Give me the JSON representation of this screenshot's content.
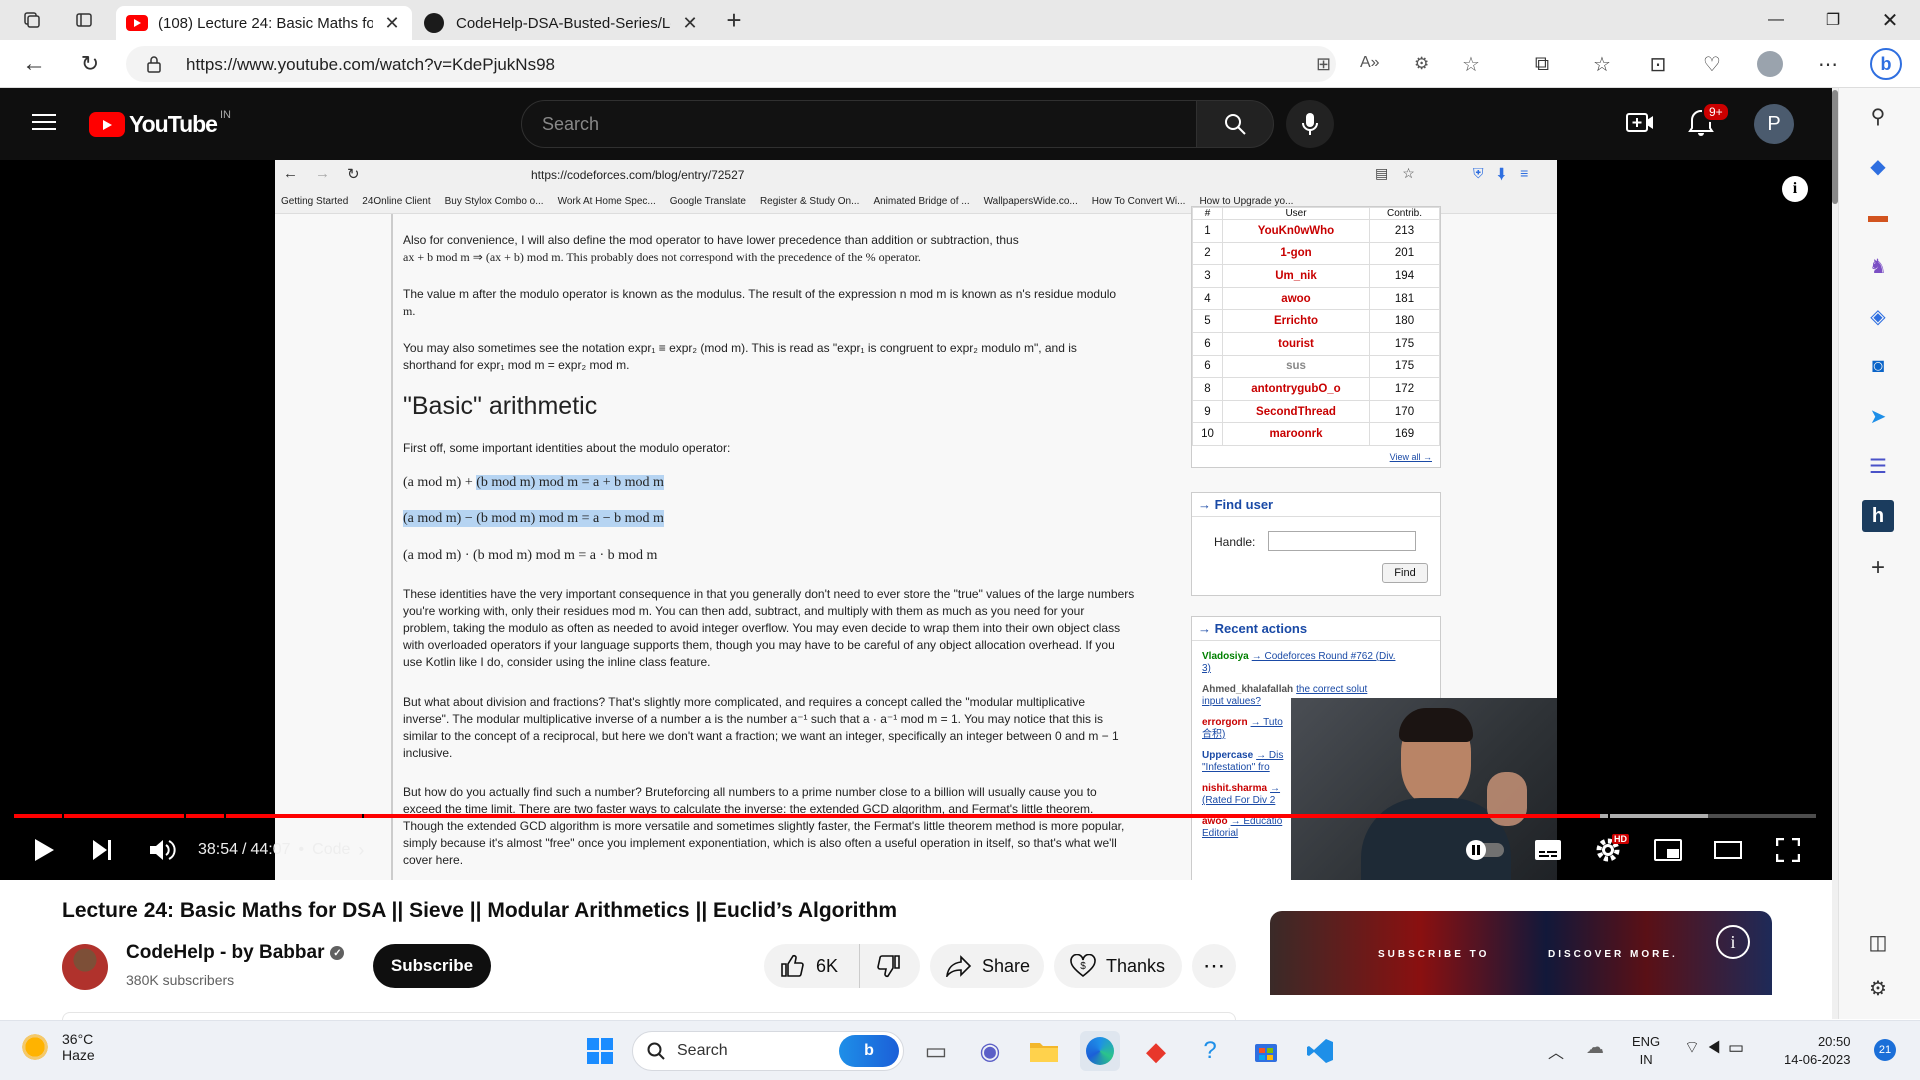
{
  "browser": {
    "tabs": [
      {
        "title": "(108) Lecture 24: Basic Maths for",
        "active": true,
        "icon": "youtube-icon"
      },
      {
        "title": "CodeHelp-DSA-Busted-Series/Le",
        "active": false,
        "icon": "github-icon"
      }
    ],
    "url": "https://www.youtube.com/watch?v=KdePjukNs98"
  },
  "youtube": {
    "logo_text": "YouTube",
    "region": "IN",
    "search_placeholder": "Search",
    "notification_count": "9+",
    "avatar_letter": "P"
  },
  "video_page": {
    "browser_url": "https://codeforces.com/blog/entry/72527",
    "bookmarks": [
      "Getting Started",
      "24Online Client",
      "Buy Stylox Combo o...",
      "Work At Home Spec...",
      "Google Translate",
      "Register & Study On...",
      "Animated Bridge of ...",
      "WallpapersWide.co...",
      "How To Convert Wi...",
      "How to Upgrade yo..."
    ],
    "para1_line1": "Also for convenience, I will also define the  mod  operator to have lower precedence than addition or subtraction, thus",
    "para1_line2": "ax + b  mod m ⇒ (ax + b) mod m. This probably does not correspond with the precedence of the  %  operator.",
    "para2_line1": "The value m after the modulo operator is known as the modulus. The result of the expression n mod m is known as n's residue modulo",
    "para2_line2": "m.",
    "para3_line1": "You may also sometimes see the notation expr₁ ≡ expr₂  (mod  m). This is read as \"expr₁ is congruent to expr₂ modulo m\", and is",
    "para3_line2": "shorthand for expr₁ mod m = expr₂ mod m.",
    "heading": "\"Basic\" arithmetic",
    "intro": "First off, some important identities about the modulo operator:",
    "identity1_a": "(a mod m) + ",
    "identity1_b": "(b mod m)  mod m = a + b  mod m",
    "identity2": "(a mod m) − (b mod m)  mod m = a − b  mod m",
    "identity3": "(a mod m) · (b mod m)  mod m = a · b  mod m",
    "para4": [
      "These identities have the very important consequence in that you generally don't need to ever store the \"true\" values of the large numbers",
      "you're working with, only their residues  mod m. You can then add, subtract, and multiply with them as much as you need for your",
      "problem, taking the modulo as often as needed to avoid integer overflow. You may even decide to wrap them into their own object class",
      "with overloaded operators if your language supports them, though you may have to be careful of any object allocation overhead. If you",
      "use Kotlin like I do, consider using the  inline class  feature."
    ],
    "para5": [
      "But what about division and fractions? That's slightly more complicated, and requires a concept called the \"modular multiplicative",
      "inverse\". The modular multiplicative inverse of a number a is the number a⁻¹ such that a · a⁻¹  mod m = 1. You may notice that this is",
      "similar to the concept of a reciprocal, but here we don't want a fraction; we want an integer, specifically an integer between 0 and m − 1",
      "inclusive."
    ],
    "para6": [
      "But how do you actually find such a number? Bruteforcing all numbers to a prime number close to a billion will usually cause you to",
      "exceed the time limit. There are two faster ways to calculate the inverse: the extended GCD algorithm, and Fermat's little theorem.",
      "Though the extended GCD algorithm is more versatile and sometimes slightly faster, the Fermat's little theorem method is more popular,",
      "simply because it's almost \"free\" once you implement exponentiation, which is also often a useful operation in itself, so that's what we'll",
      "cover here."
    ],
    "header_user": "User",
    "header_contrib": "Contrib.",
    "ranking": [
      {
        "rank": "1",
        "user": "YouKn0wWho",
        "contrib": "213",
        "color": "#c80000"
      },
      {
        "rank": "2",
        "user": "1-gon",
        "contrib": "201",
        "color": "#c80000"
      },
      {
        "rank": "3",
        "user": "Um_nik",
        "contrib": "194",
        "color": "#c80000"
      },
      {
        "rank": "4",
        "user": "awoo",
        "contrib": "181",
        "color": "#c80000"
      },
      {
        "rank": "5",
        "user": "Errichto",
        "contrib": "180",
        "color": "#c80000"
      },
      {
        "rank": "6",
        "user": "tourist",
        "contrib": "175",
        "color": "#c80000"
      },
      {
        "rank": "6",
        "user": "sus",
        "contrib": "175",
        "color": "#888888"
      },
      {
        "rank": "8",
        "user": "antontrygubO_o",
        "contrib": "172",
        "color": "#c80000"
      },
      {
        "rank": "9",
        "user": "SecondThread",
        "contrib": "170",
        "color": "#c80000"
      },
      {
        "rank": "10",
        "user": "maroonrk",
        "contrib": "169",
        "color": "#c80000"
      }
    ],
    "view_all": "View all →",
    "find_user_title": "→ Find user",
    "handle_label": "Handle:",
    "find_button": "Find",
    "recent_title": "→ Recent actions",
    "recent": [
      {
        "user": "Vladosiya",
        "text": "→ Codeforces Round #762 (Div.",
        "text2": "3)"
      },
      {
        "user": "Ahmed_khalafallah",
        "text": "the correct solut",
        "text2": "input values?"
      },
      {
        "user": "errorgorn",
        "text": "→ Tuto",
        "text2": "合积)"
      },
      {
        "user": "Uppercase",
        "text": "→ Dis",
        "text2": "\"Infestation\" fro"
      },
      {
        "user": "nishit.sharma",
        "text": "→",
        "text2": "(Rated For Div 2"
      },
      {
        "user": "awoo",
        "text": "→ Educatio",
        "text2": "Editorial"
      }
    ]
  },
  "player": {
    "time_current": "38:54",
    "time_total": "44:07",
    "chapter": "Code",
    "progress": 0.88,
    "hd_badge": "HD"
  },
  "video": {
    "title": "Lecture 24: Basic Maths for DSA || Sieve || Modular Arithmetics || Euclid’s Algorithm",
    "channel": "CodeHelp - by Babbar",
    "subscribers": "380K subscribers",
    "subscribe_label": "Subscribe",
    "likes": "6K",
    "share_label": "Share",
    "thanks_label": "Thanks",
    "ad_text_1": "SUBSCRIBE TO",
    "ad_text_2": "DISCOVER MORE."
  },
  "taskbar": {
    "temperature": "36°C",
    "weather": "Haze",
    "search_label": "Search",
    "lang_1": "ENG",
    "lang_2": "IN",
    "time": "20:50",
    "date": "14-06-2023",
    "notifications": "21"
  },
  "colors": {
    "yt_red": "#ff0000",
    "yt_dark": "#0f0f0f",
    "cf_red": "#c80000",
    "cf_blue": "#1a4aa6",
    "highlight": "#b6d4f2"
  }
}
